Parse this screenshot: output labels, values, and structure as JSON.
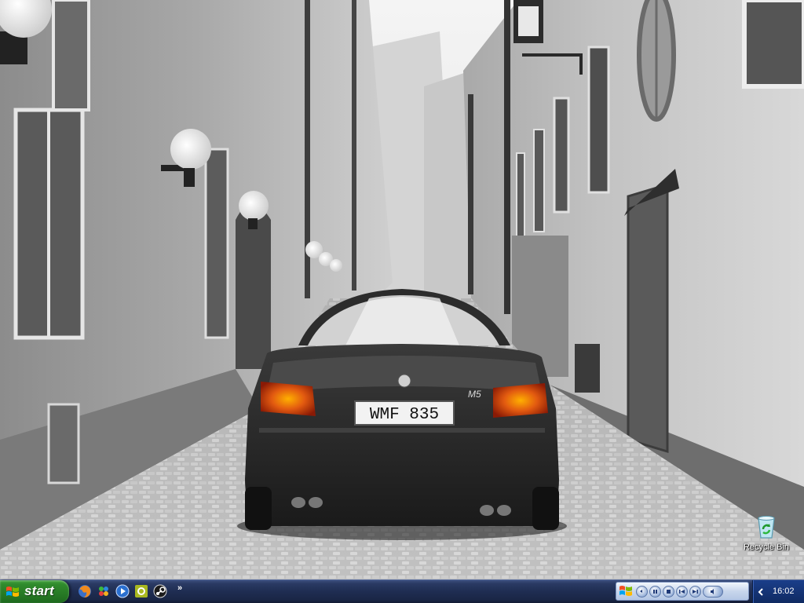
{
  "desktop": {
    "icons": [
      {
        "label": "Recycle Bin",
        "icon": "recycle-bin-icon"
      }
    ],
    "wallpaper": {
      "plate_text": "WMF 835",
      "badge_text": "M5"
    }
  },
  "taskbar": {
    "start_label": "start",
    "quick_launch": [
      "firefox-icon",
      "messenger-icon",
      "media-player-icon",
      "app-icon",
      "steam-icon"
    ],
    "more_glyph": "»",
    "media_bar": {
      "buttons": [
        "restore-icon",
        "play-pause-icon",
        "stop-icon",
        "prev-icon",
        "next-icon",
        "volume-icon"
      ]
    },
    "tray": {
      "clock": "16:02",
      "expand_glyph": "<"
    }
  },
  "colors": {
    "taskbar": "#1f2d52",
    "start": "#2f8a2c",
    "tail_light": "#d83a10"
  }
}
